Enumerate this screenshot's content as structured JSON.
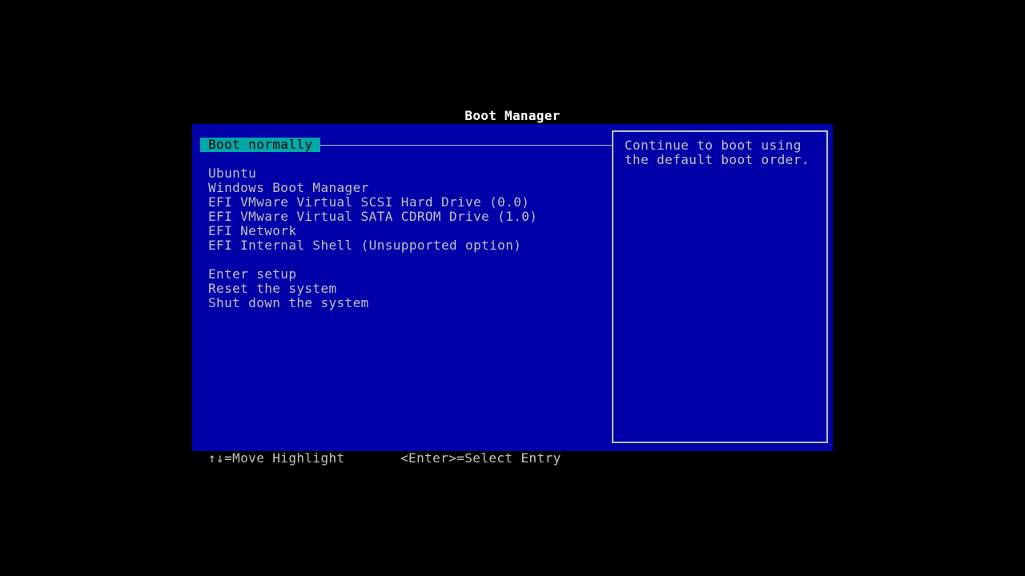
{
  "header": {
    "title": "Boot Manager"
  },
  "menu": {
    "selected_index": 0,
    "groups": [
      [
        "Boot normally"
      ],
      [
        "Ubuntu",
        "Windows Boot Manager",
        "EFI VMware Virtual SCSI Hard Drive (0.0)",
        "EFI VMware Virtual SATA CDROM Drive (1.0)",
        "EFI Network",
        "EFI Internal Shell (Unsupported option)"
      ],
      [
        "Enter setup",
        "Reset the system",
        "Shut down the system"
      ]
    ]
  },
  "help": {
    "text": "Continue to boot using\nthe default boot order."
  },
  "footer": {
    "move_hint": "↑↓=Move Highlight",
    "select_hint": "<Enter>=Select Entry"
  },
  "colors": {
    "background": "#000000",
    "panel": "#0000a8",
    "text": "#c0c0c0",
    "highlight": "#00a8a8",
    "title": "#ffffff"
  }
}
